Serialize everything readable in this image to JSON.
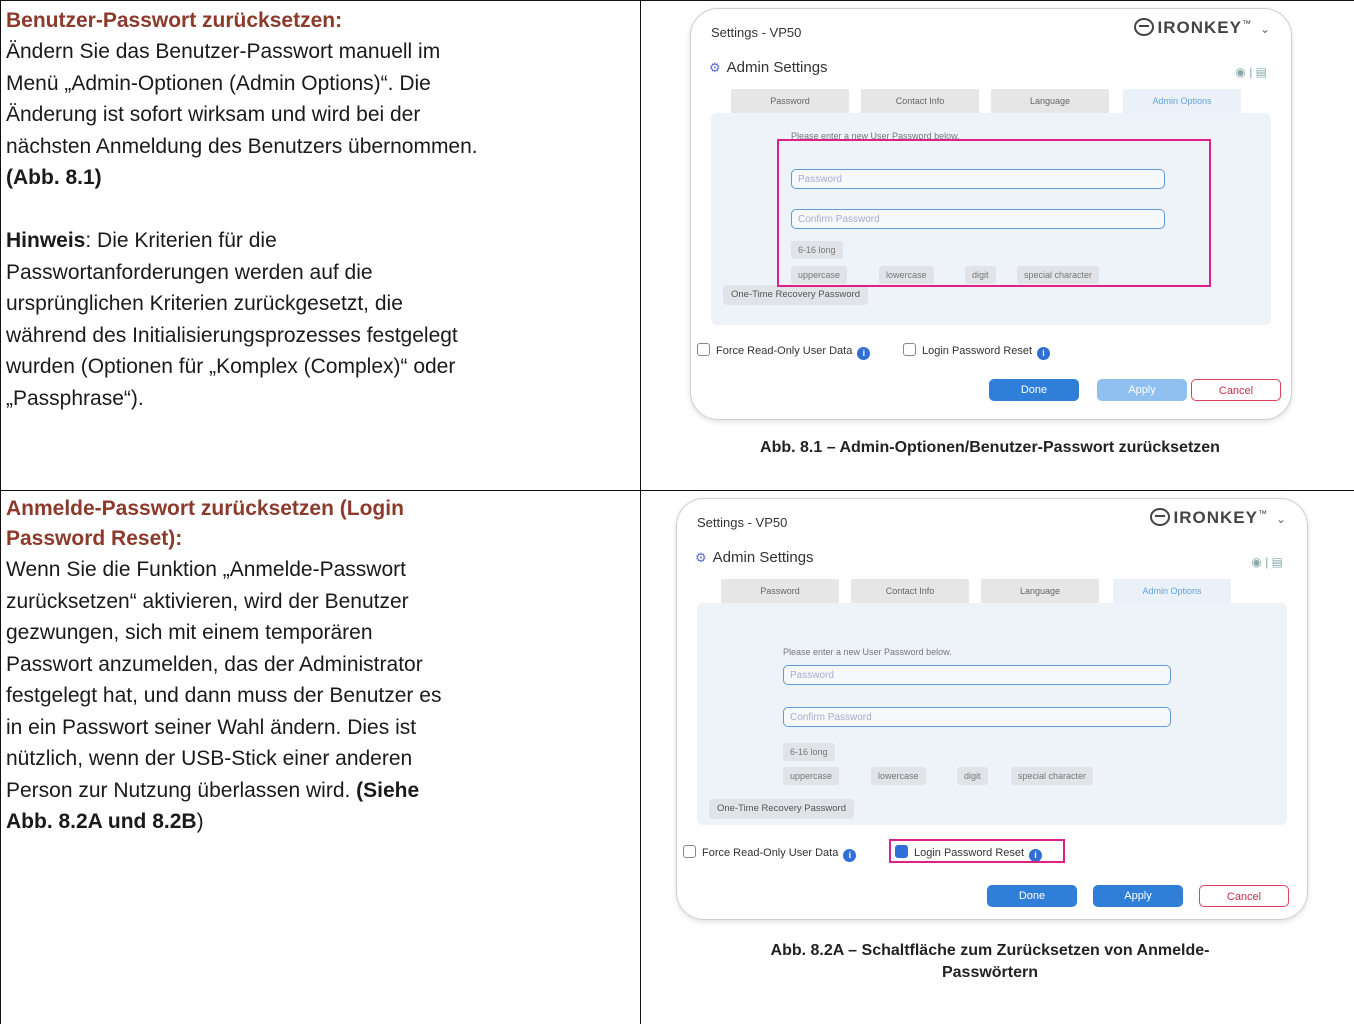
{
  "section1": {
    "heading": "Benutzer-Passwort zurücksetzen:",
    "body_lines": [
      "Ändern Sie das Benutzer-Passwort manuell im",
      "Menü „Admin-Optionen (Admin Options)“. Die",
      "Änderung ist sofort wirksam und wird bei der",
      "nächsten Anmeldung des Benutzers übernommen."
    ],
    "ref": "(Abb. 8.1)",
    "note_label": "Hinweis",
    "note_lines": [
      ": Die Kriterien für die",
      "Passwortanforderungen werden auf die",
      "ursprünglichen Kriterien zurückgesetzt, die",
      "während des Initialisierungsprozesses festgelegt",
      "wurden (Optionen für „Komplex (Complex)“ oder",
      "„Passphrase“)."
    ],
    "caption": "Abb. 8.1 – Admin-Optionen/Benutzer-Passwort zurücksetzen"
  },
  "section2": {
    "heading_lines": [
      "Anmelde-Passwort zurücksetzen (Login",
      "Password Reset):"
    ],
    "body_lines": [
      "Wenn Sie die Funktion „Anmelde-Passwort",
      "zurücksetzen“ aktivieren, wird der Benutzer",
      "gezwungen, sich mit einem temporären",
      "Passwort anzumelden, das der Administrator",
      "festgelegt hat, und dann muss der Benutzer es",
      "in ein Passwort seiner Wahl ändern. Dies ist",
      "nützlich, wenn der USB-Stick einer anderen",
      "Person zur Nutzung überlassen wird. "
    ],
    "ref_bold": "(Siehe",
    "ref_line2_bold": "Abb. 8.2A und 8.2B",
    "ref_line2_end": ")",
    "caption_lines": [
      "Abb. 8.2A – Schaltfläche zum Zurücksetzen von Anmelde-",
      "Passwörtern"
    ]
  },
  "window": {
    "title": "Settings - VP50",
    "brand": "IRONKEY",
    "brand_tm": "™",
    "chevron": "⌄",
    "admin_title": "Admin Settings",
    "tabs": [
      "Password",
      "Contact Info",
      "Language",
      "Admin Options"
    ],
    "prompt": "Please enter a new User Password below.",
    "password_placeholder": "Password",
    "confirm_placeholder": "Confirm Password",
    "length_chip": "6-16 long",
    "criteria": [
      "uppercase",
      "lowercase",
      "digit",
      "special character"
    ],
    "recovery": "One-Time Recovery Password",
    "force_readonly": "Force Read-Only User Data",
    "login_reset": "Login Password Reset",
    "done": "Done",
    "apply": "Apply",
    "cancel": "Cancel"
  },
  "colors": {
    "heading": "#8b3a2b",
    "highlight": "#e0208a",
    "accent": "#2f7fd8"
  }
}
